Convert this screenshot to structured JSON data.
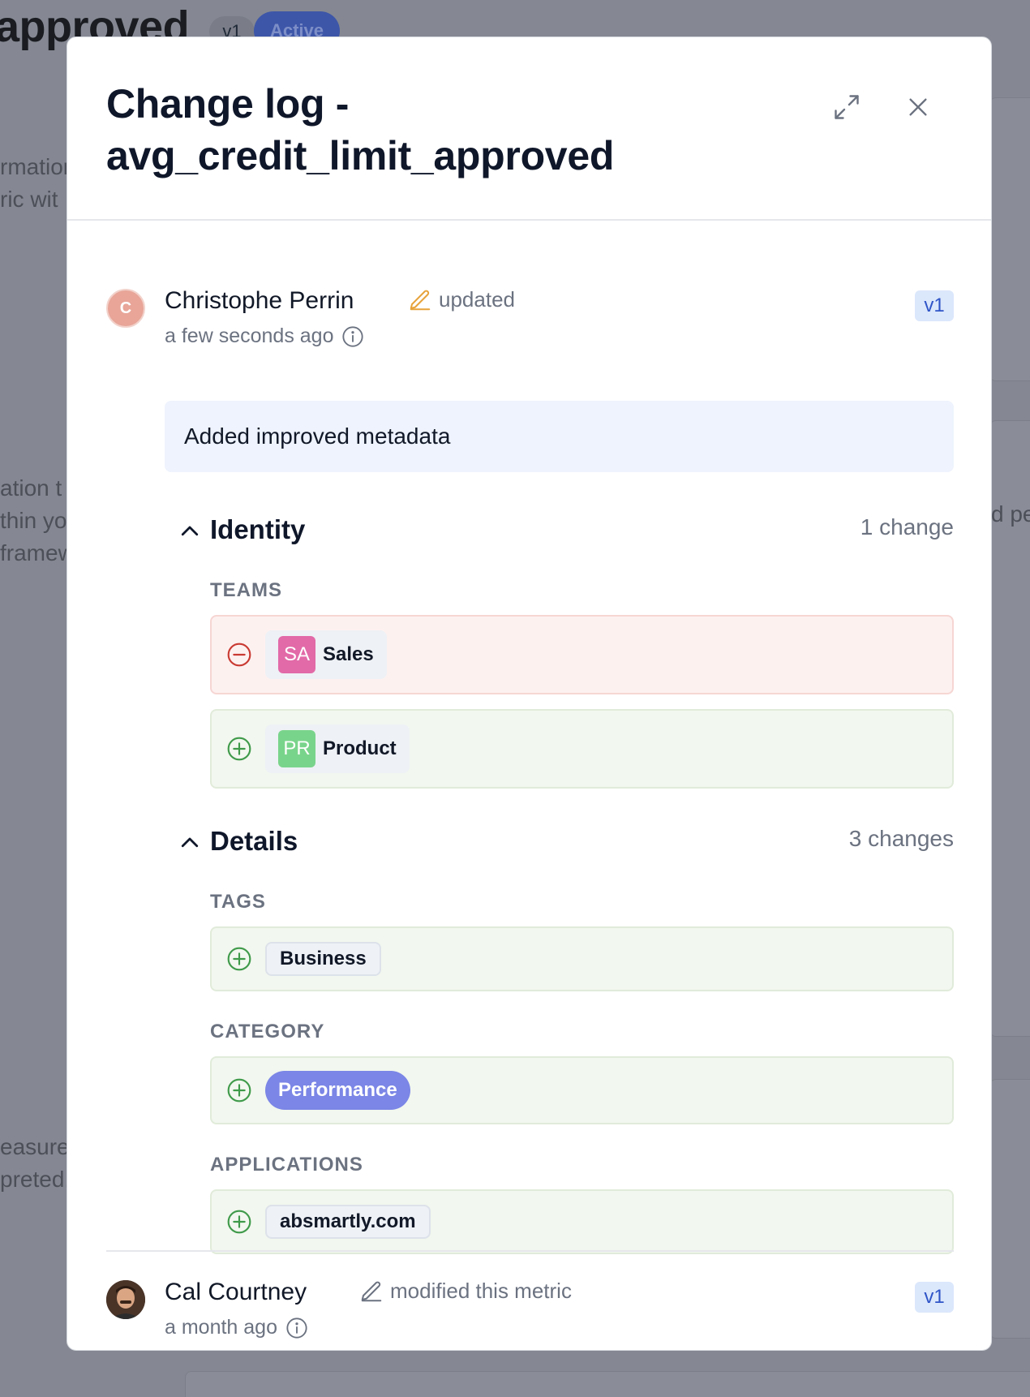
{
  "background": {
    "title_fragment": "approved",
    "version": "v1",
    "status": "Active",
    "text_lines_a": [
      "rmation",
      "ric wit"
    ],
    "text_lines_b": [
      "ation t",
      "thin yo",
      "framew"
    ],
    "text_lines_c": [
      "easure",
      "preted."
    ],
    "text_right": "d pe"
  },
  "modal": {
    "title_line1": "Change log -",
    "title_line2": "avg_credit_limit_approved"
  },
  "entries": [
    {
      "author": "Christophe Perrin",
      "avatar_initial": "C",
      "action": "updated",
      "time": "a few seconds ago",
      "version": "v1",
      "comment": "Added improved metadata",
      "sections": [
        {
          "title": "Identity",
          "count": "1 change",
          "fields": [
            {
              "label": "TEAMS",
              "removed": [
                {
                  "initials": "SA",
                  "name": "Sales",
                  "color": "#e26aa8"
                }
              ],
              "added": [
                {
                  "initials": "PR",
                  "name": "Product",
                  "color": "#79d48b"
                }
              ]
            }
          ]
        },
        {
          "title": "Details",
          "count": "3 changes",
          "fields": [
            {
              "label": "TAGS",
              "added": [
                "Business"
              ]
            },
            {
              "label": "CATEGORY",
              "added": [
                "Performance"
              ]
            },
            {
              "label": "APPLICATIONS",
              "added": [
                "absmartly.com"
              ]
            }
          ]
        }
      ]
    },
    {
      "author": "Cal Courtney",
      "action": "modified this metric",
      "time": "a month ago",
      "version": "v1"
    }
  ],
  "icons": {
    "expand": "expand-icon",
    "close": "close-icon",
    "pencil": "pencil-icon",
    "info": "info-icon",
    "chevron": "chevron-up-icon",
    "removed": "minus-circle-icon",
    "added": "plus-circle-icon"
  },
  "colors": {
    "removed_icon": "#c93a32",
    "added_icon": "#3f9a4a",
    "pencil_first": "#e7a33a",
    "version_badge": "#2f55c7",
    "christophe_avatar": "#e8a598",
    "category_chip": "#7b86e6"
  }
}
